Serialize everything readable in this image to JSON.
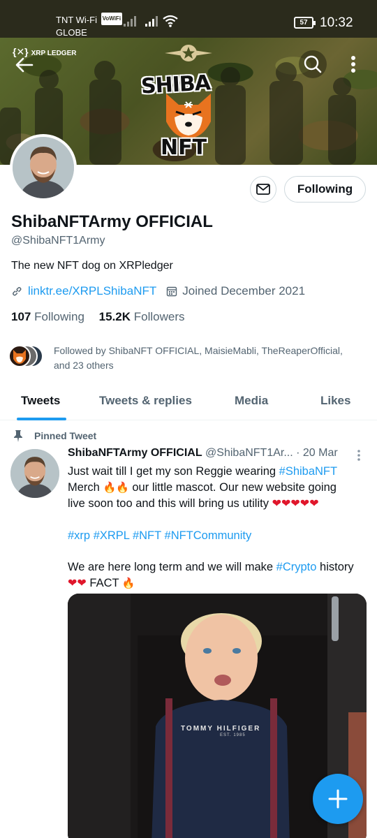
{
  "status_bar": {
    "carrier_line1": "TNT Wi-Fi",
    "vowifi_badge": "VoWiFi",
    "carrier_line2": "GLOBE",
    "battery": "57",
    "time": "10:32"
  },
  "banner": {
    "xrp_logo_text": "XRP LEDGER",
    "title_top": "SHIBA",
    "title_bottom": "NFT"
  },
  "profile": {
    "following_button": "Following",
    "display_name": "ShibaNFTArmy OFFICIAL",
    "handle": "@ShibaNFT1Army",
    "bio": "The new NFT dog on XRPledger",
    "link": "linktr.ee/XRPLShibaNFT",
    "joined": "Joined December 2021",
    "following_count": "107",
    "following_label": "Following",
    "followers_count": "15.2K",
    "followers_label": "Followers",
    "followed_by_line1": "Followed by ShibaNFT OFFICIAL, MaisieMabli, TheReaperOfficial,",
    "followed_by_line2": "and 23 others"
  },
  "tabs": [
    {
      "label": "Tweets",
      "active": true
    },
    {
      "label": "Tweets & replies",
      "active": false
    },
    {
      "label": "Media",
      "active": false
    },
    {
      "label": "Likes",
      "active": false
    }
  ],
  "tweet": {
    "pinned_label": "Pinned Tweet",
    "author_name": "ShibaNFTArmy OFFICIAL",
    "author_handle": "@ShibaNFT1Ar...",
    "date": "· 20 Mar",
    "line1_pre": "Just wait till I get my son Reggie wearing ",
    "line1_tag": "#ShibaNFT",
    "line2_pre": "Merch ",
    "line2_post": " our little mascot. Our new website going",
    "line3": "live soon too and this will bring us utility ",
    "hashtags": [
      "#xrp",
      "#XRPL",
      "#NFT",
      "#NFTCommunity"
    ],
    "line5_pre": "We are here long term and we will make ",
    "line5_tag": "#Crypto",
    "line5_post": " history",
    "line6_post": " FACT ",
    "shirt_text": "TOMMY HILFIGER",
    "shirt_subtext": "EST. 1985"
  },
  "icons": {
    "back": "arrow-left-icon",
    "search": "search-icon",
    "more": "more-vertical-icon",
    "message": "envelope-icon",
    "link": "link-icon",
    "calendar": "calendar-icon",
    "pin": "pin-icon",
    "compose": "plus-icon"
  },
  "colors": {
    "accent": "#1d9bf0",
    "text_primary": "#0f1419",
    "text_secondary": "#536471",
    "heart": "#e0162b"
  }
}
